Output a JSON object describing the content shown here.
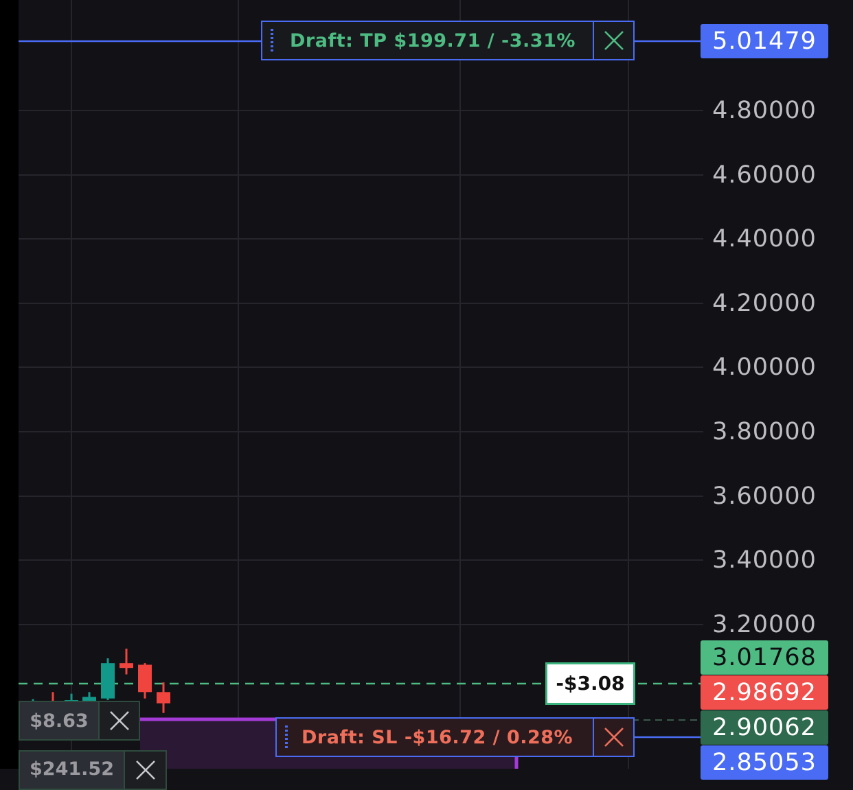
{
  "chart_data": {
    "type": "candlestick",
    "y_range": [
      2.83,
      5.06
    ],
    "y_ticks": [
      "4.80000",
      "4.60000",
      "4.40000",
      "4.20000",
      "4.00000",
      "3.80000",
      "3.60000",
      "3.40000",
      "3.20000"
    ],
    "grid": true,
    "candles": [
      {
        "open": 2.955,
        "close": 2.96,
        "high": 2.968,
        "low": 2.95,
        "dir": "up"
      },
      {
        "open": 2.96,
        "close": 2.962,
        "high": 2.99,
        "low": 2.955,
        "dir": "down"
      },
      {
        "open": 2.96,
        "close": 2.965,
        "high": 2.985,
        "low": 2.95,
        "dir": "up"
      },
      {
        "open": 2.955,
        "close": 2.975,
        "high": 2.99,
        "low": 2.945,
        "dir": "up"
      },
      {
        "open": 2.97,
        "close": 3.08,
        "high": 3.095,
        "low": 2.965,
        "dir": "up"
      },
      {
        "open": 3.08,
        "close": 3.065,
        "high": 3.125,
        "low": 3.045,
        "dir": "down"
      },
      {
        "open": 3.075,
        "close": 2.99,
        "high": 3.08,
        "low": 2.97,
        "dir": "down"
      },
      {
        "open": 2.99,
        "close": 2.955,
        "high": 3.02,
        "low": 2.925,
        "dir": "down"
      }
    ],
    "levels": {
      "take_profit_draft": 5.01479,
      "current_price": 3.01768,
      "entry_price": 2.98692,
      "liquidation_like": 2.90062,
      "stop_loss_draft": 2.85053
    }
  },
  "price_tags": {
    "tp": "5.01479",
    "current": "3.01768",
    "entry": "2.98692",
    "dark_green": "2.90062",
    "sl": "2.85053"
  },
  "orders": {
    "tp_label": "Draft: TP $199.71 / -3.31%",
    "sl_label": "Draft: SL -$16.72 / 0.28%",
    "pnl_label": "-$3.08",
    "position_pnl": "$8.63",
    "position_pnl_2": "$241.52"
  },
  "colors": {
    "background": "#121116",
    "up": "#12998a",
    "down": "#f0443f",
    "tp_text": "#4dbb82",
    "sl_text": "#f06f5a",
    "accent_blue": "#4a6cf4",
    "current_tag": "#4dbb82",
    "entry_tag": "#f04f4b",
    "dark_green_tag": "#2e6a4d",
    "purple": "#a43bd6"
  },
  "icons": {
    "close": "close-x-icon",
    "grip": "drag-grip-icon"
  }
}
